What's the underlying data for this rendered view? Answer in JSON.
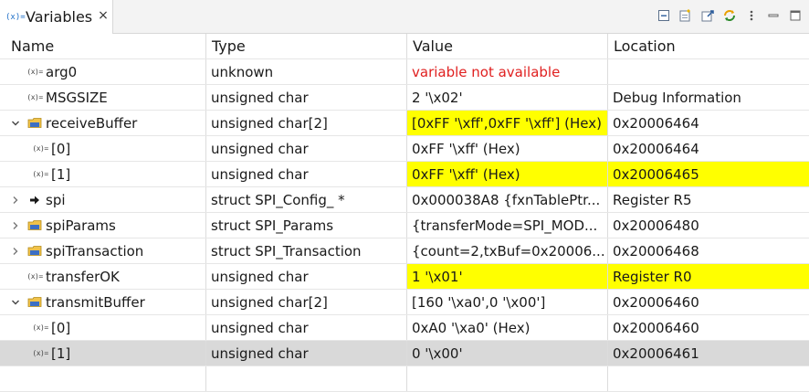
{
  "tab": {
    "icon_text": "(x)=",
    "title": "Variables",
    "close_glyph": "×"
  },
  "columns": [
    "Name",
    "Type",
    "Value",
    "Location"
  ],
  "rows": [
    {
      "name": "arg0",
      "type": "unknown",
      "value": "variable not available",
      "location": "",
      "level": 0,
      "twisty": "none",
      "icon": "variable-icon",
      "value_style": "error",
      "loc_style": "",
      "selected": false
    },
    {
      "name": "MSGSIZE",
      "type": "unsigned char",
      "value": "2 '\\x02'",
      "location": "Debug Information",
      "level": 0,
      "twisty": "none",
      "icon": "variable-icon",
      "value_style": "",
      "loc_style": "",
      "selected": false
    },
    {
      "name": "receiveBuffer",
      "type": "unsigned char[2]",
      "value": "[0xFF '\\xff',0xFF '\\xff'] (Hex)",
      "location": "0x20006464",
      "level": 0,
      "twisty": "expanded",
      "icon": "struct-icon",
      "value_style": "highlight",
      "loc_style": "",
      "selected": false
    },
    {
      "name": "[0]",
      "type": "unsigned char",
      "value": "0xFF '\\xff' (Hex)",
      "location": "0x20006464",
      "level": 1,
      "twisty": "none",
      "icon": "variable-icon",
      "value_style": "",
      "loc_style": "",
      "selected": false
    },
    {
      "name": "[1]",
      "type": "unsigned char",
      "value": "0xFF '\\xff' (Hex)",
      "location": "0x20006465",
      "level": 1,
      "twisty": "none",
      "icon": "variable-icon",
      "value_style": "highlight",
      "loc_style": "highlight",
      "selected": false
    },
    {
      "name": "spi",
      "type": "struct SPI_Config_ *",
      "value": "0x000038A8 {fxnTablePtr...",
      "location": "Register R5",
      "level": 0,
      "twisty": "collapsed",
      "icon": "pointer-icon",
      "value_style": "",
      "loc_style": "",
      "selected": false
    },
    {
      "name": "spiParams",
      "type": "struct SPI_Params",
      "value": "{transferMode=SPI_MOD...",
      "location": "0x20006480",
      "level": 0,
      "twisty": "collapsed",
      "icon": "struct-icon",
      "value_style": "",
      "loc_style": "",
      "selected": false
    },
    {
      "name": "spiTransaction",
      "type": "struct SPI_Transaction",
      "value": "{count=2,txBuf=0x20006...",
      "location": "0x20006468",
      "level": 0,
      "twisty": "collapsed",
      "icon": "struct-icon",
      "value_style": "",
      "loc_style": "",
      "selected": false
    },
    {
      "name": "transferOK",
      "type": "unsigned char",
      "value": "1 '\\x01'",
      "location": "Register R0",
      "level": 0,
      "twisty": "none",
      "icon": "variable-icon",
      "value_style": "highlight",
      "loc_style": "highlight",
      "selected": false
    },
    {
      "name": "transmitBuffer",
      "type": "unsigned char[2]",
      "value": "[160 '\\xa0',0 '\\x00']",
      "location": "0x20006460",
      "level": 0,
      "twisty": "expanded",
      "icon": "struct-icon",
      "value_style": "",
      "loc_style": "",
      "selected": false
    },
    {
      "name": "[0]",
      "type": "unsigned char",
      "value": "0xA0 '\\xa0' (Hex)",
      "location": "0x20006460",
      "level": 1,
      "twisty": "none",
      "icon": "variable-icon",
      "value_style": "",
      "loc_style": "",
      "selected": false
    },
    {
      "name": "[1]",
      "type": "unsigned char",
      "value": "0 '\\x00'",
      "location": "0x20006461",
      "level": 1,
      "twisty": "none",
      "icon": "variable-icon",
      "value_style": "",
      "loc_style": "",
      "selected": true
    }
  ],
  "colors": {
    "highlight": "#ffff00",
    "error_text": "#e02020",
    "selected_row": "#d9d9d9",
    "variable_icon_blue": "#1e6ec8"
  },
  "toolbar_icons": [
    "collapse-all-icon",
    "new-expression-icon",
    "select-columns-icon",
    "refresh-icon",
    "view-menu-icon",
    "minimize-icon",
    "maximize-icon"
  ]
}
